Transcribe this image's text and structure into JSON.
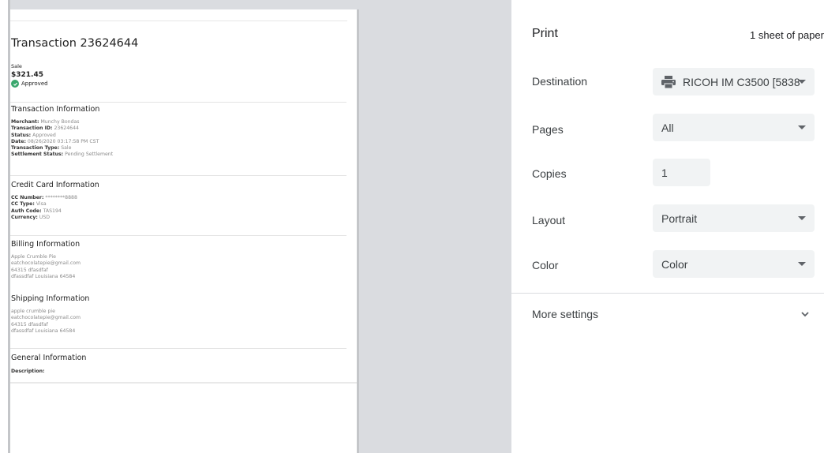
{
  "preview": {
    "title": "Transaction 23624644",
    "sale_label": "Sale",
    "amount": "$321.45",
    "approved": "Approved",
    "sections": [
      {
        "heading": "Transaction Information",
        "lines": [
          {
            "label": "Merchant:",
            "value": "Munchy Bondas"
          },
          {
            "label": "Transaction ID:",
            "value": "23624644"
          },
          {
            "label": "Status:",
            "value": "Approved"
          },
          {
            "label": "Date:",
            "value": "08/26/2020 03:17:58 PM CST"
          },
          {
            "label": "Transaction Type:",
            "value": "Sale"
          },
          {
            "label": "Settlement Status:",
            "value": "Pending Settlement"
          }
        ]
      },
      {
        "heading": "Credit Card Information",
        "lines": [
          {
            "label": "CC Number:",
            "value": "********8888"
          },
          {
            "label": "CC Type:",
            "value": "Visa"
          },
          {
            "label": "Auth Code:",
            "value": "TAS194"
          },
          {
            "label": "Currency:",
            "value": "USD"
          }
        ]
      },
      {
        "heading": "Billing Information",
        "lines": [
          {
            "value": "Apple Crumble Pie"
          },
          {
            "value": "eatchocolatepie@gmail.com"
          },
          {
            "value": "64315 dfasdfaf"
          },
          {
            "value": "dfassdfaf Louisiana 64584"
          }
        ]
      },
      {
        "heading": "Shipping Information",
        "lines": [
          {
            "value": "apple crumble pie"
          },
          {
            "value": "eatchocolatepie@gmail.com"
          },
          {
            "value": "64315 dfasdfaf"
          },
          {
            "value": "dfassdfaf Louisiana 64584"
          }
        ]
      },
      {
        "heading": "General Information",
        "lines": [
          {
            "label": "Description:",
            "value": ""
          }
        ]
      }
    ]
  },
  "print": {
    "title": "Print",
    "sheets": "1 sheet of paper",
    "destination": {
      "label": "Destination",
      "value": "RICOH IM C3500 [5838",
      "icon": "printer-icon"
    },
    "pages": {
      "label": "Pages",
      "value": "All"
    },
    "copies": {
      "label": "Copies",
      "value": "1"
    },
    "layout": {
      "label": "Layout",
      "value": "Portrait"
    },
    "color": {
      "label": "Color",
      "value": "Color"
    },
    "more_settings": {
      "label": "More settings",
      "icon": "chevron-down-icon"
    }
  }
}
